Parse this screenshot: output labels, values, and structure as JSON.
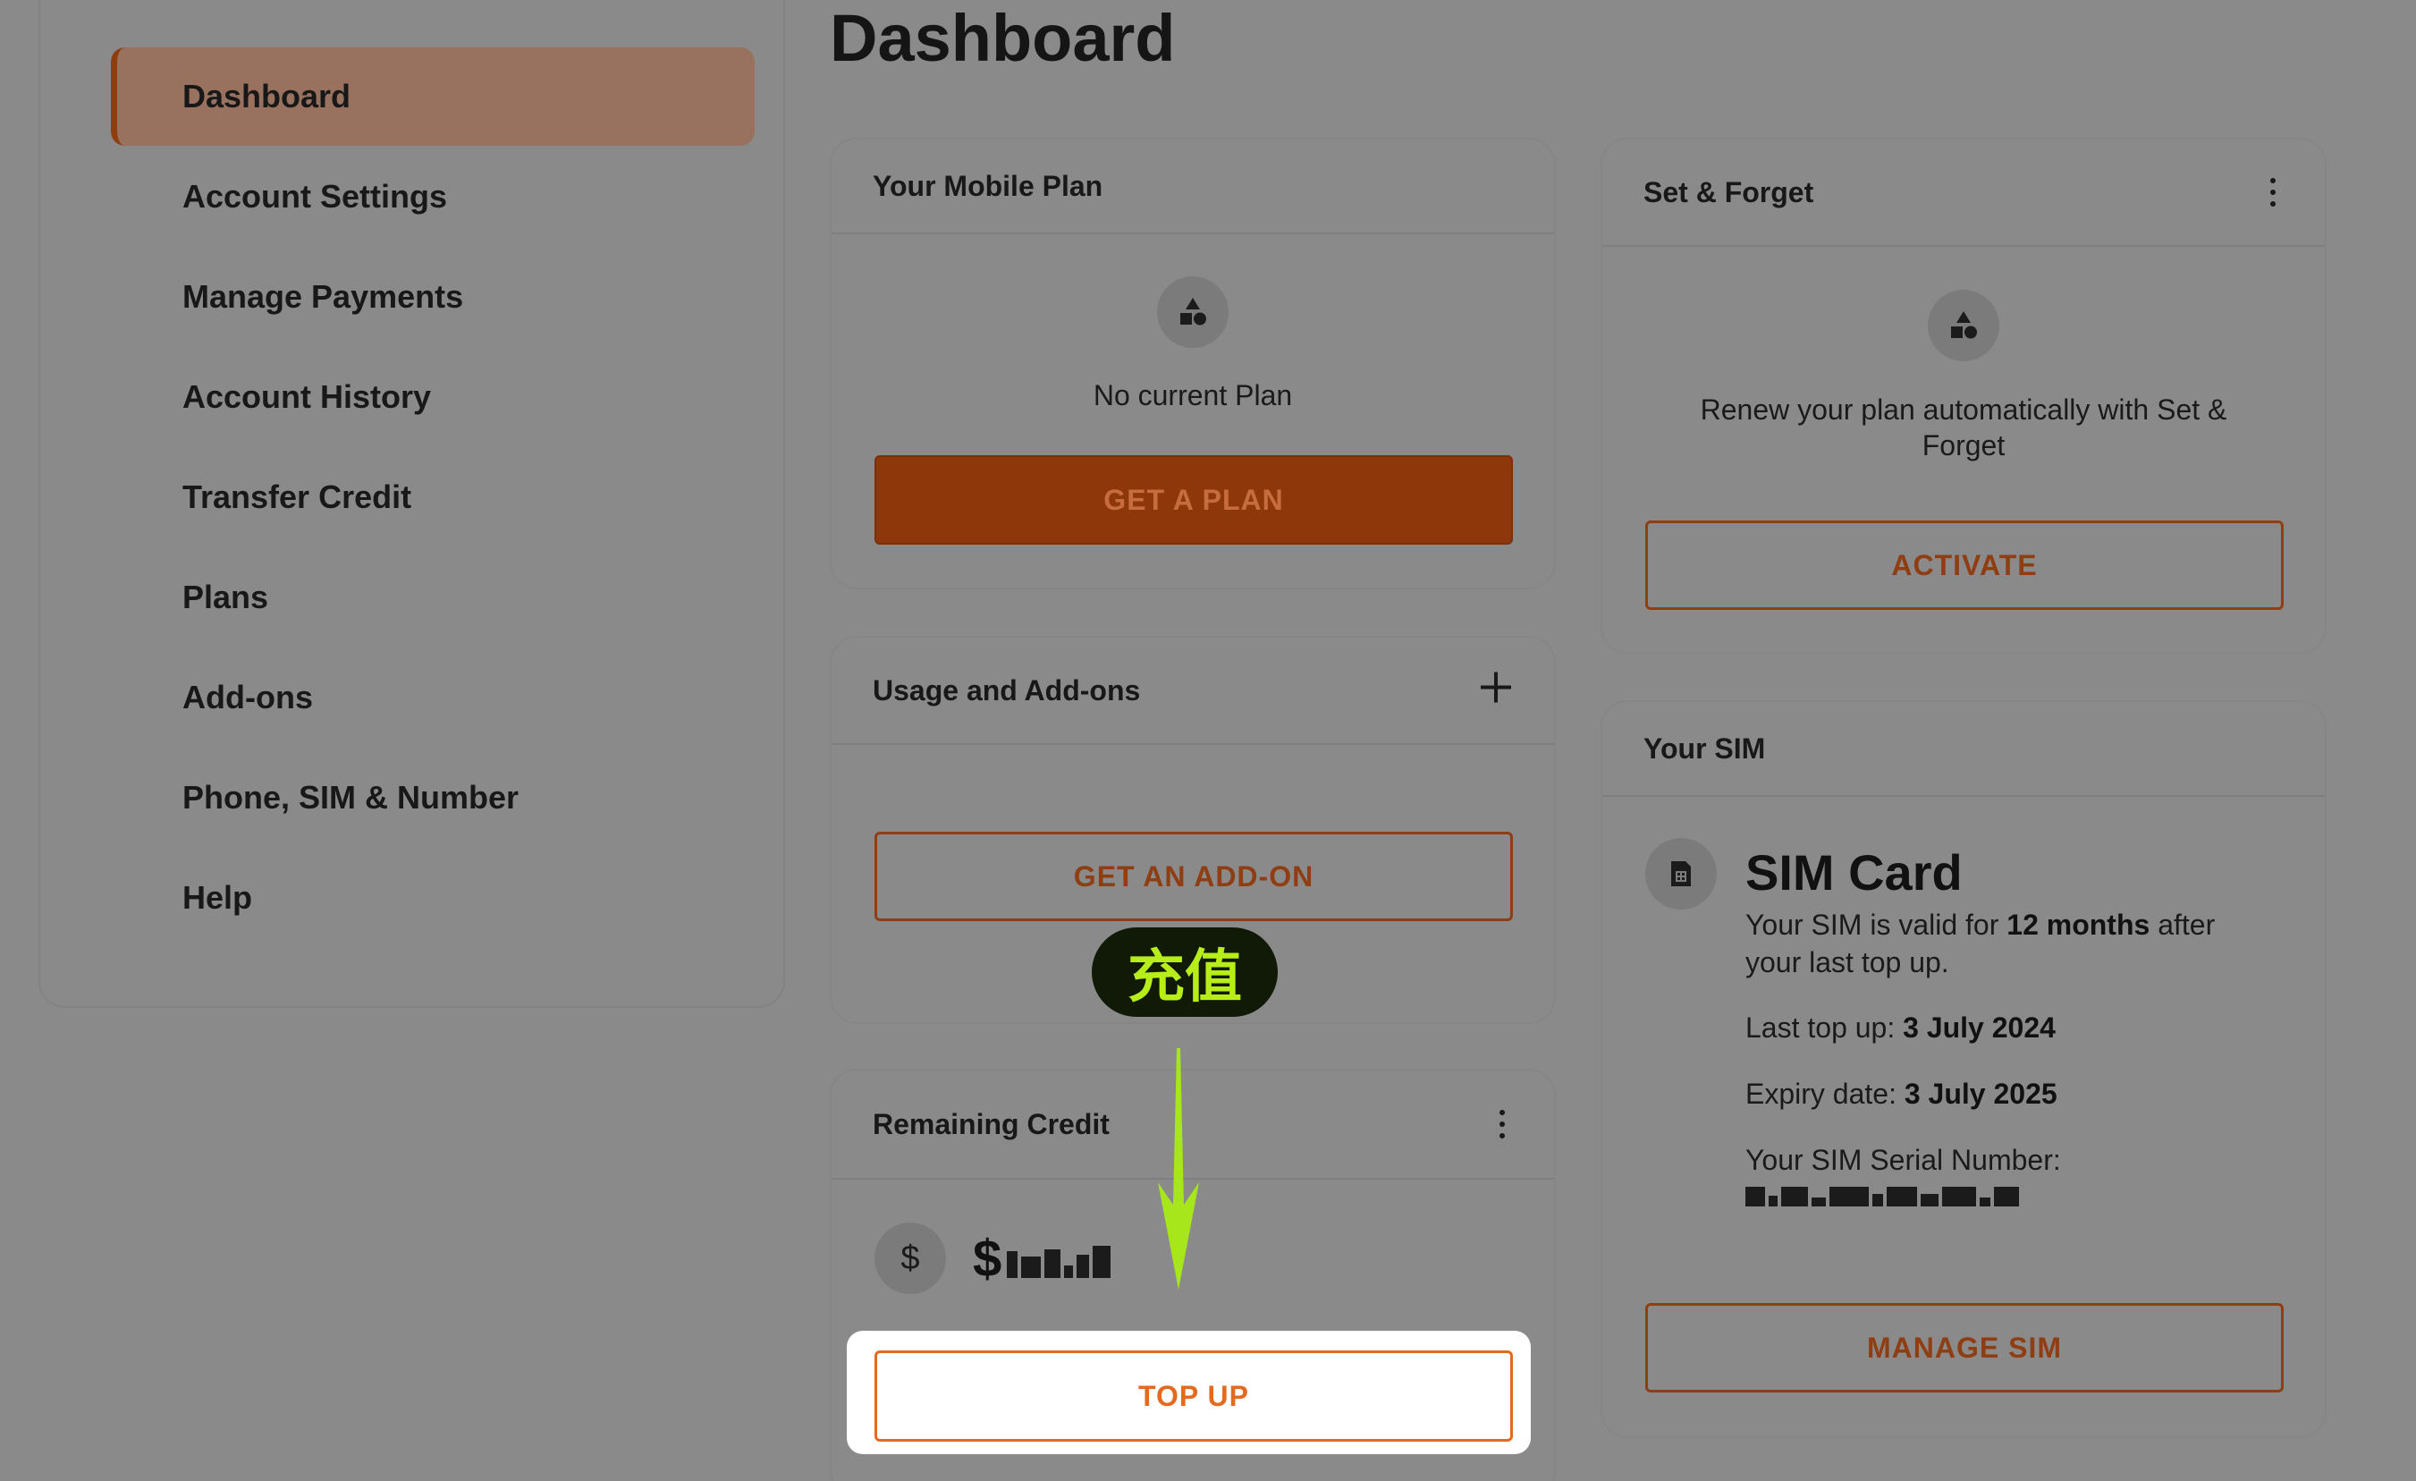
{
  "sidebar": {
    "items": [
      {
        "label": "Dashboard",
        "active": true
      },
      {
        "label": "Account Settings"
      },
      {
        "label": "Manage Payments"
      },
      {
        "label": "Account History"
      },
      {
        "label": "Transfer Credit"
      },
      {
        "label": "Plans"
      },
      {
        "label": "Add-ons"
      },
      {
        "label": "Phone, SIM & Number"
      },
      {
        "label": "Help"
      }
    ]
  },
  "page": {
    "title": "Dashboard"
  },
  "mobile_plan": {
    "title": "Your Mobile Plan",
    "icon": "shapes-icon",
    "message": "No current Plan",
    "button": "GET A PLAN"
  },
  "set_forget": {
    "title": "Set & Forget",
    "icon": "shapes-icon",
    "message_line1": "Renew your plan automatically with Set &",
    "message_line2": "Forget",
    "button": "ACTIVATE"
  },
  "usage": {
    "title": "Usage and Add-ons",
    "add_icon": "plus-icon",
    "button": "GET AN ADD-ON"
  },
  "credit": {
    "title": "Remaining Credit",
    "currency_icon": "dollar-icon",
    "currency_symbol": "$",
    "amount_obscured": true,
    "button": "TOP UP"
  },
  "sim": {
    "title": "Your SIM",
    "card_title": "SIM Card",
    "valid_prefix": "Your SIM is valid for ",
    "valid_value": "12 months",
    "valid_suffix": " after",
    "valid_line2": "your last top up.",
    "last_topup_label": "Last top up: ",
    "last_topup_value": "3 July 2024",
    "expiry_label": "Expiry date: ",
    "expiry_value": "3 July 2025",
    "serial_label": "Your SIM Serial Number:",
    "serial_obscured": true,
    "button": "MANAGE SIM"
  },
  "annotation": {
    "label": "充值",
    "colors": {
      "label_text": "#b7ee1a",
      "label_bg": "#111a06",
      "arrow": "#a6e61a"
    }
  },
  "colors": {
    "accent": "#e36a1e",
    "accent_dim": "#8e3e12",
    "overlay_bg": "#8a8a8a",
    "highlight": "#ffffff"
  }
}
